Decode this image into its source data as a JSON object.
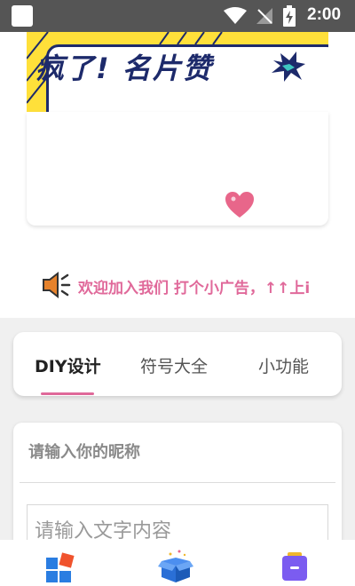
{
  "status_bar": {
    "time": "2:00",
    "icons": [
      "app-icon",
      "wifi-icon",
      "no-signal-icon",
      "battery-icon"
    ]
  },
  "banner": {
    "title": "疯了! 名片赞",
    "colors": {
      "background": "#ffe03a",
      "text": "#1d2a6b"
    }
  },
  "marquee": {
    "text": "欢迎加入我们 打个小广告，↑↑上i",
    "color": "#e0699a"
  },
  "tabs": [
    {
      "label": "DIY设计",
      "active": true
    },
    {
      "label": "符号大全",
      "active": false
    },
    {
      "label": "小功能",
      "active": false
    }
  ],
  "form": {
    "nickname_label": "请输入你的昵称",
    "text_placeholder": "请输入文字内容"
  },
  "bottom_nav": {
    "items": [
      "diy-icon",
      "gift-box-icon",
      "tool-icon"
    ]
  },
  "accent_color": "#e0699a"
}
